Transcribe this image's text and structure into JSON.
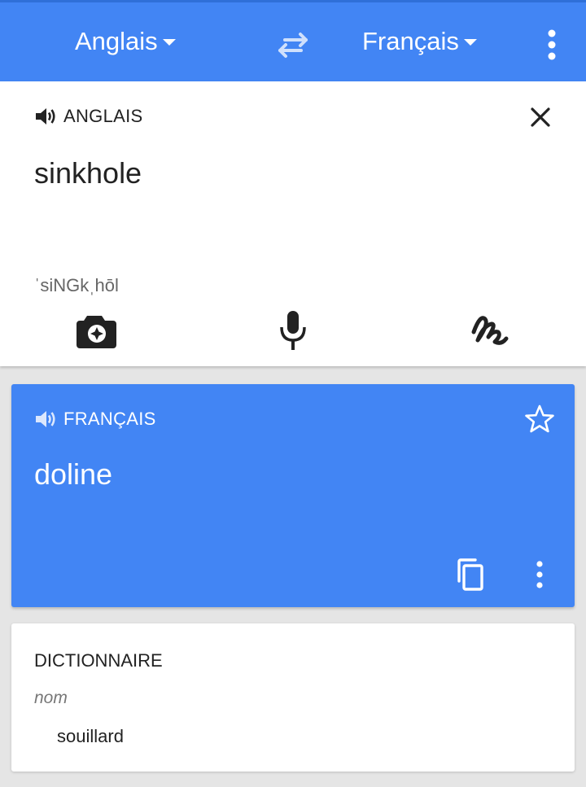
{
  "header": {
    "source_lang": "Anglais",
    "target_lang": "Français",
    "icons": [
      "swap-icon",
      "more-vert-icon"
    ],
    "color": "#4285f4"
  },
  "input": {
    "lang_label": "ANGLAIS",
    "text": "sinkhole",
    "phonetic": "ˈsiNGkˌhōl",
    "tools": [
      "camera-icon",
      "microphone-icon",
      "handwriting-icon"
    ]
  },
  "result": {
    "lang_label": "FRANÇAIS",
    "text": "doline",
    "icons": [
      "speaker-icon",
      "star-icon",
      "copy-icon",
      "more-vert-icon"
    ]
  },
  "dictionary": {
    "title": "DICTIONNAIRE",
    "part_of_speech": "nom",
    "entries": [
      "souillard"
    ]
  }
}
